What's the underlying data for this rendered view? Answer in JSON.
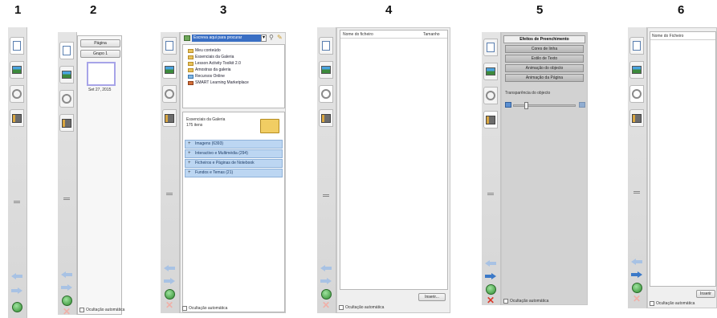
{
  "figure_labels": [
    "1",
    "2",
    "3",
    "4",
    "5",
    "6"
  ],
  "colors": {
    "tab_strip": "#d6d6d6",
    "accent_blue": "#3b79c8",
    "gallery_row": "#bcd6f2",
    "delete_red": "#d93a2b"
  },
  "icons": [
    "page-icon",
    "gallery-icon",
    "attachment-icon",
    "properties-icon",
    "back-arrow-icon",
    "forward-arrow-icon",
    "globe-icon",
    "delete-icon"
  ],
  "panel2": {
    "add_page_button": "Página",
    "group_button": "Grupo 1",
    "thumbnail_caption": "Set 27, 2015",
    "auto_hide_label": "Ocultação automática"
  },
  "panel3": {
    "search_placeholder": "Escreva aqui para procurar",
    "tree_items": [
      "Meu conteúdo",
      "Essenciais da Galeria",
      "Lesson Activity Toolkit 2.0",
      "Amostras da galeria",
      "Recursos Online",
      "SMART Learning Marketplace"
    ],
    "gallery_title": "Essenciais da Galeria",
    "gallery_count": "175 itens",
    "gallery_categories": [
      "Imagens (6393)",
      "Interactivo e Multimédia (294)",
      "Ficheiros e Páginas de Notebook",
      "Fundos e Temas (21)"
    ],
    "auto_hide_label": "Ocultação automática"
  },
  "panel4": {
    "col_name": "Nome do ficheiro",
    "col_size": "Tamanho",
    "insert_button": "Inserir...",
    "auto_hide_label": "Ocultação automática"
  },
  "panel5": {
    "title": "Efeitos de Preenchimento",
    "buttons": [
      "Cores de linha",
      "Estilo de Texto",
      "Animação do objecto",
      "Animação da Página"
    ],
    "transparency_label": "Transparência do objecto",
    "transparency_fraction": 0.2,
    "auto_hide_label": "Ocultação automática"
  },
  "panel6": {
    "col_name": "Nome do Ficheiro",
    "insert_button": "Inserir",
    "auto_hide_label": "Ocultação automática"
  }
}
